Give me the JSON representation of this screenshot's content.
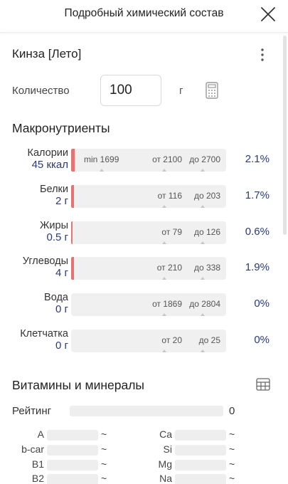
{
  "header": {
    "title": "Подробный химический состав"
  },
  "product": {
    "name": "Кинза [Лето]"
  },
  "quantity": {
    "label": "Количество",
    "value": "100",
    "unit": "г"
  },
  "macros": {
    "title": "Макронутриенты",
    "rows": [
      {
        "name": "Калории",
        "value": "45 ккал",
        "min": "min 1699",
        "from": "от 2100",
        "to": "до 2700",
        "percent": "2.1%",
        "fill_fraction": 0.021,
        "color": "#e57373"
      },
      {
        "name": "Белки",
        "value": "2 г",
        "min": "",
        "from": "от 116",
        "to": "до 203",
        "percent": "1.7%",
        "fill_fraction": 0.017,
        "color": "#e57373"
      },
      {
        "name": "Жиры",
        "value": "0.5 г",
        "min": "",
        "from": "от 79",
        "to": "до 126",
        "percent": "0.6%",
        "fill_fraction": 0.006,
        "color": "#e57373"
      },
      {
        "name": "Углеводы",
        "value": "4 г",
        "min": "",
        "from": "от 210",
        "to": "до 338",
        "percent": "1.9%",
        "fill_fraction": 0.019,
        "color": "#e57373"
      },
      {
        "name": "Вода",
        "value": "0 г",
        "min": "",
        "from": "от 1869",
        "to": "до 2804",
        "percent": "0%",
        "fill_fraction": 0,
        "color": "#e57373"
      },
      {
        "name": "Клетчатка",
        "value": "0 г",
        "min": "",
        "from": "от 20",
        "to": "до 25",
        "percent": "0%",
        "fill_fraction": 0,
        "color": "#e57373"
      }
    ]
  },
  "vitamins": {
    "title": "Витамины и минералы",
    "rating_label": "Рейтинг",
    "rating_value": "0",
    "left": [
      {
        "name": "A",
        "value": "~"
      },
      {
        "name": "b-car",
        "value": "~"
      },
      {
        "name": "B1",
        "value": "~"
      },
      {
        "name": "B2",
        "value": "~"
      }
    ],
    "right": [
      {
        "name": "Ca",
        "value": "~"
      },
      {
        "name": "Si",
        "value": "~"
      },
      {
        "name": "Mg",
        "value": "~"
      },
      {
        "name": "Na",
        "value": "~"
      }
    ]
  },
  "icons": {
    "close": "close-icon",
    "more": "more-vertical-icon",
    "calculator": "calculator-icon",
    "table": "table-icon"
  },
  "colors": {
    "accent_value": "#2b3a78",
    "fill": "#e57373",
    "bar_bg": "#f0f0f0"
  }
}
